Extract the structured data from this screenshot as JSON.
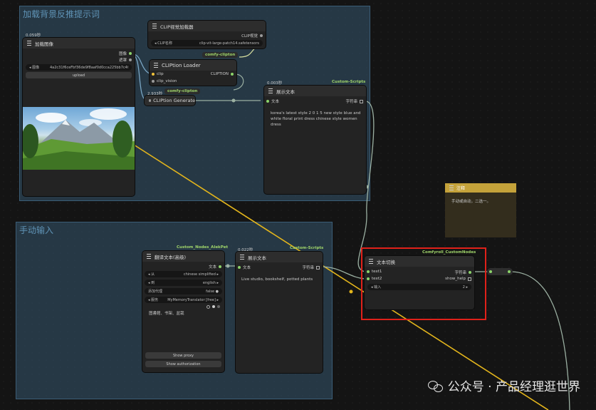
{
  "groups": {
    "top": {
      "title": "加载背景反推提示词"
    },
    "bottom": {
      "title": "手动输入"
    }
  },
  "load_image": {
    "timing": "0.059秒",
    "title": "加载图像",
    "out_image": "图像",
    "out_mask": "遮罩",
    "image_field_label": "◂ 图像",
    "image_field_value": "4a2c31f6ceFbf36de9f8aaf0d0cca225bb7c4f3...",
    "upload_label": "upload"
  },
  "clip_model_loader": {
    "title": "CLIP视觉加载器",
    "out_label": "CLIP视觉",
    "field_label": "◂ CLIP名称",
    "field_value": "clip-vit-large-patch14.safetensors",
    "badge": "comfy-clipton"
  },
  "clipton_loader": {
    "title": "CLIPtion Loader",
    "in_clip": "clip",
    "in_clip_vision": "clip_vision",
    "out_label": "CLIPTION"
  },
  "clipton_generate": {
    "timing": "2.933秒",
    "badge": "comfy-clipton",
    "title": "CLIPtion Generate"
  },
  "show_text_top": {
    "timing": "0.003秒",
    "badge": "Custom-Scripts",
    "title": "展示文本",
    "in_text": "文本",
    "out_string": "字符串",
    "content": "korea's latest style 2 0 1 5 new style blue and white floral print dress chinese style women dress"
  },
  "translate": {
    "badge": "Custom_Nodes_AlekPet",
    "title": "翻译文本(高级)",
    "out_text": "文本",
    "widgets": [
      {
        "label": "◂ 从",
        "value": "chinese simplified ▸"
      },
      {
        "label": "◂ 到",
        "value": "english ▸"
      },
      {
        "label": "添加代理",
        "value": "false ●"
      },
      {
        "label": "◂ 服务",
        "value": "MyMemoryTranslator [free] ▸"
      }
    ],
    "input_text": "图書館、书架、盆栽",
    "btn_proxy": "Show proxy",
    "btn_auth": "Show authorization"
  },
  "show_text_bottom": {
    "timing": "0.022秒",
    "badge": "Custom-Scripts",
    "title": "展示文本",
    "in_text": "文本",
    "out_string": "字符串",
    "content": "Live studio, bookshelf, potted plants"
  },
  "note": {
    "title": "注释",
    "content": "手动或自动，二选一。"
  },
  "text_switch": {
    "badge": "Comfyroll_CustomNodes",
    "title": "文本切换",
    "in_text1": "text1",
    "in_text2": "text2",
    "out_string": "字符串",
    "out_show_help": "show_help",
    "field_label": "◂ 输入",
    "field_value": "2 ▸"
  },
  "watermark": {
    "text": "公众号 · 产品经理逛世界"
  },
  "colors": {
    "group": "#34566e",
    "accent_green": "#8bd36a",
    "highlight_red": "#e0211a",
    "note_yellow": "#c4a23a",
    "wire_yellow": "#e3b51c"
  }
}
